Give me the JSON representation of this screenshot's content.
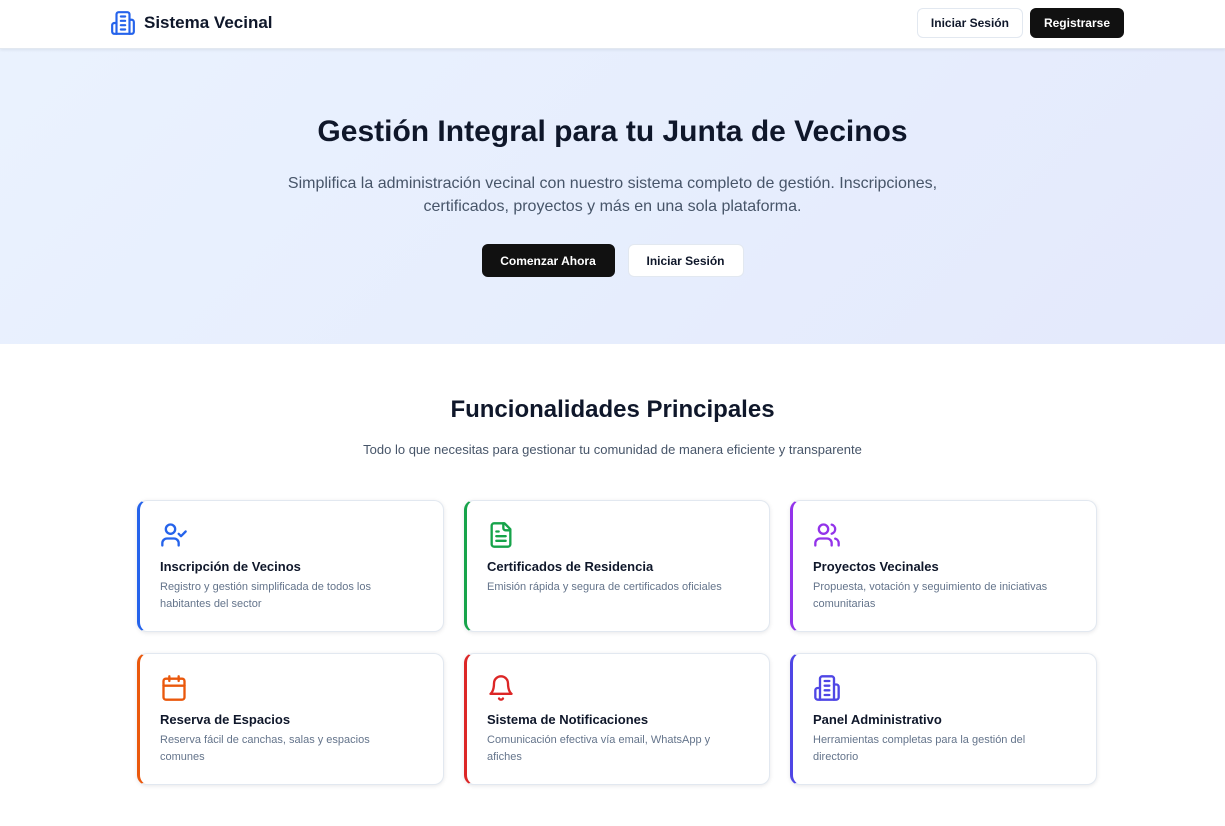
{
  "header": {
    "brand": "Sistema Vecinal",
    "login_label": "Iniciar Sesión",
    "register_label": "Registrarse"
  },
  "hero": {
    "title": "Gestión Integral para tu Junta de Vecinos",
    "subtitle": "Simplifica la administración vecinal con nuestro sistema completo de gestión. Inscripciones, certificados, proyectos y más en una sola plataforma.",
    "primary_cta": "Comenzar Ahora",
    "secondary_cta": "Iniciar Sesión"
  },
  "features": {
    "title": "Funcionalidades Principales",
    "subtitle": "Todo lo que necesitas para gestionar tu comunidad de manera eficiente y transparente",
    "items": [
      {
        "title": "Inscripción de Vecinos",
        "description": "Registro y gestión simplificada de todos los habitantes del sector",
        "icon": "user-check-icon",
        "color": "#2563eb"
      },
      {
        "title": "Certificados de Residencia",
        "description": "Emisión rápida y segura de certificados oficiales",
        "icon": "file-text-icon",
        "color": "#16a34a"
      },
      {
        "title": "Proyectos Vecinales",
        "description": "Propuesta, votación y seguimiento de iniciativas comunitarias",
        "icon": "users-icon",
        "color": "#9333ea"
      },
      {
        "title": "Reserva de Espacios",
        "description": "Reserva fácil de canchas, salas y espacios comunes",
        "icon": "calendar-icon",
        "color": "#ea580c"
      },
      {
        "title": "Sistema de Notificaciones",
        "description": "Comunicación efectiva vía email, WhatsApp y afiches",
        "icon": "bell-icon",
        "color": "#dc2626"
      },
      {
        "title": "Panel Administrativo",
        "description": "Herramientas completas para la gestión del directorio",
        "icon": "building-icon",
        "color": "#4f46e5"
      }
    ]
  },
  "colors": {
    "brand": "#2563eb",
    "dark_button": "#111111",
    "hero_bg": "#e8effd"
  }
}
